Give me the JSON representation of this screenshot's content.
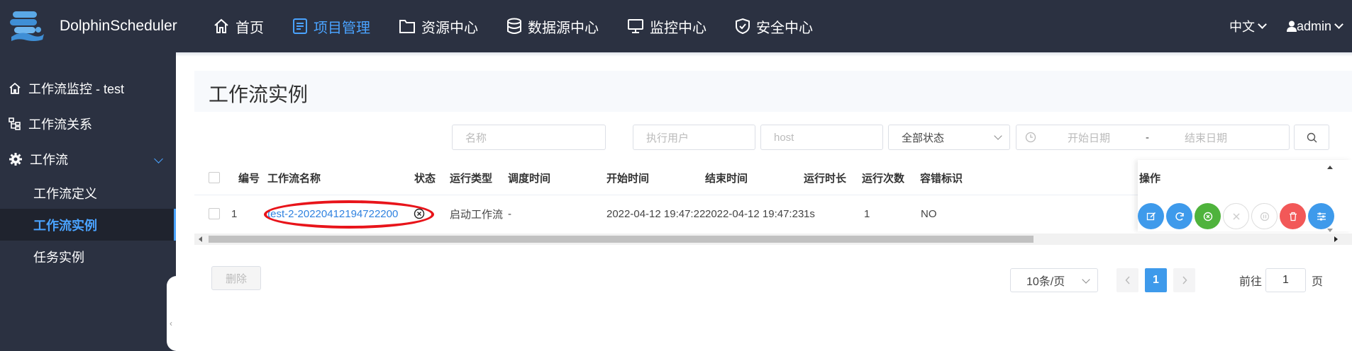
{
  "app": {
    "name": "DolphinScheduler"
  },
  "nav": {
    "items": [
      {
        "label": "首页",
        "icon": "home-icon",
        "active": false
      },
      {
        "label": "项目管理",
        "icon": "project-icon",
        "active": true
      },
      {
        "label": "资源中心",
        "icon": "folder-icon",
        "active": false
      },
      {
        "label": "数据源中心",
        "icon": "database-icon",
        "active": false
      },
      {
        "label": "监控中心",
        "icon": "monitor-icon",
        "active": false
      },
      {
        "label": "安全中心",
        "icon": "shield-icon",
        "active": false
      }
    ],
    "language": "中文",
    "user": "admin"
  },
  "sidebar": {
    "items": [
      {
        "label": "工作流监控 - test",
        "icon": "home-icon"
      },
      {
        "label": "工作流关系",
        "icon": "tree-icon"
      },
      {
        "label": "工作流",
        "icon": "gear-icon",
        "expanded": true
      }
    ],
    "subitems": [
      {
        "label": "工作流定义",
        "active": false
      },
      {
        "label": "工作流实例",
        "active": true
      },
      {
        "label": "任务实例",
        "active": false
      }
    ]
  },
  "page": {
    "title": "工作流实例"
  },
  "filters": {
    "name_placeholder": "名称",
    "user_placeholder": "执行用户",
    "host_placeholder": "host",
    "status_value": "全部状态",
    "start_date_placeholder": "开始日期",
    "date_separator": "-",
    "end_date_placeholder": "结束日期"
  },
  "table": {
    "headers": {
      "no": "编号",
      "name": "工作流名称",
      "state": "状态",
      "run_type": "运行类型",
      "schedule_time": "调度时间",
      "start_time": "开始时间",
      "end_time": "结束时间",
      "duration": "运行时长",
      "run_times": "运行次数",
      "fault_tolerant": "容错标识",
      "operation": "操作"
    },
    "rows": [
      {
        "no": "1",
        "name": "test-2-20220412194722200",
        "run_type": "启动工作流",
        "schedule_time": "-",
        "start_time": "2022-04-12 19:47:22",
        "end_time": "2022-04-12 19:47:23",
        "duration": "1s",
        "run_times": "1",
        "fault_tolerant": "NO"
      }
    ],
    "actions": [
      {
        "icon": "edit-icon",
        "color": "#3e9aeb",
        "enabled": true
      },
      {
        "icon": "rerun-icon",
        "color": "#3e9aeb",
        "enabled": true
      },
      {
        "icon": "recover-icon",
        "color": "#4fb33c",
        "enabled": true
      },
      {
        "icon": "stop-icon",
        "color": "#cccccc",
        "enabled": false
      },
      {
        "icon": "pause-icon",
        "color": "#cccccc",
        "enabled": false
      },
      {
        "icon": "delete-icon",
        "color": "#f25858",
        "enabled": true
      },
      {
        "icon": "gantt-icon",
        "color": "#3e9aeb",
        "enabled": true
      }
    ]
  },
  "footer": {
    "delete_label": "删除",
    "page_size": "10条/页",
    "current_page": "1",
    "goto_prefix": "前往",
    "goto_value": "1",
    "goto_suffix": "页"
  },
  "annotation": {
    "color": "#e8141a"
  }
}
